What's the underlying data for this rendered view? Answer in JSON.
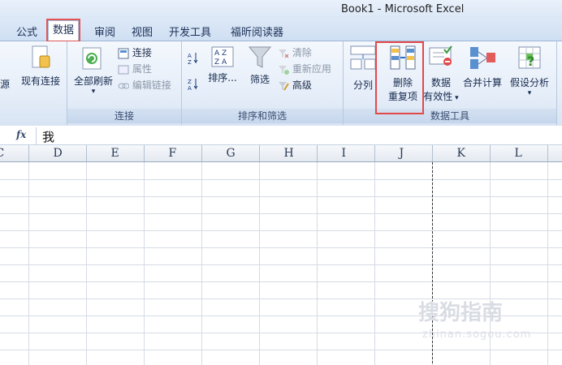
{
  "window": {
    "title": "Book1 - Microsoft Excel"
  },
  "tabs": [
    "公式",
    "数据",
    "审阅",
    "视图",
    "开发工具",
    "福昕阅读器"
  ],
  "ribbon": {
    "get_external": {
      "partial_label": "源",
      "existing_connections": "现有连接"
    },
    "connections": {
      "refresh_all": "全部刷新",
      "connections": "连接",
      "properties": "属性",
      "edit_links": "编辑链接",
      "group": "连接"
    },
    "sort_filter": {
      "sort": "排序...",
      "filter": "筛选",
      "clear": "清除",
      "reapply": "重新应用",
      "advanced": "高级",
      "group": "排序和筛选"
    },
    "data_tools": {
      "text_to_columns": "分列",
      "remove_dup_line1": "删除",
      "remove_dup_line2": "重复项",
      "validation_line1": "数据",
      "validation_line2": "有效性",
      "consolidate": "合并计算",
      "what_if": "假设分析",
      "group": "数据工具"
    }
  },
  "formula_bar": {
    "fx": "fx",
    "value": "我"
  },
  "columns": [
    "C",
    "D",
    "E",
    "F",
    "G",
    "H",
    "I",
    "J",
    "K",
    "L"
  ],
  "watermark": {
    "main": "搜狗指南",
    "sub": "zhinan.sogou.com"
  },
  "colors": {
    "highlight": "#e34848",
    "ribbon_bg": "#e6eef9"
  }
}
